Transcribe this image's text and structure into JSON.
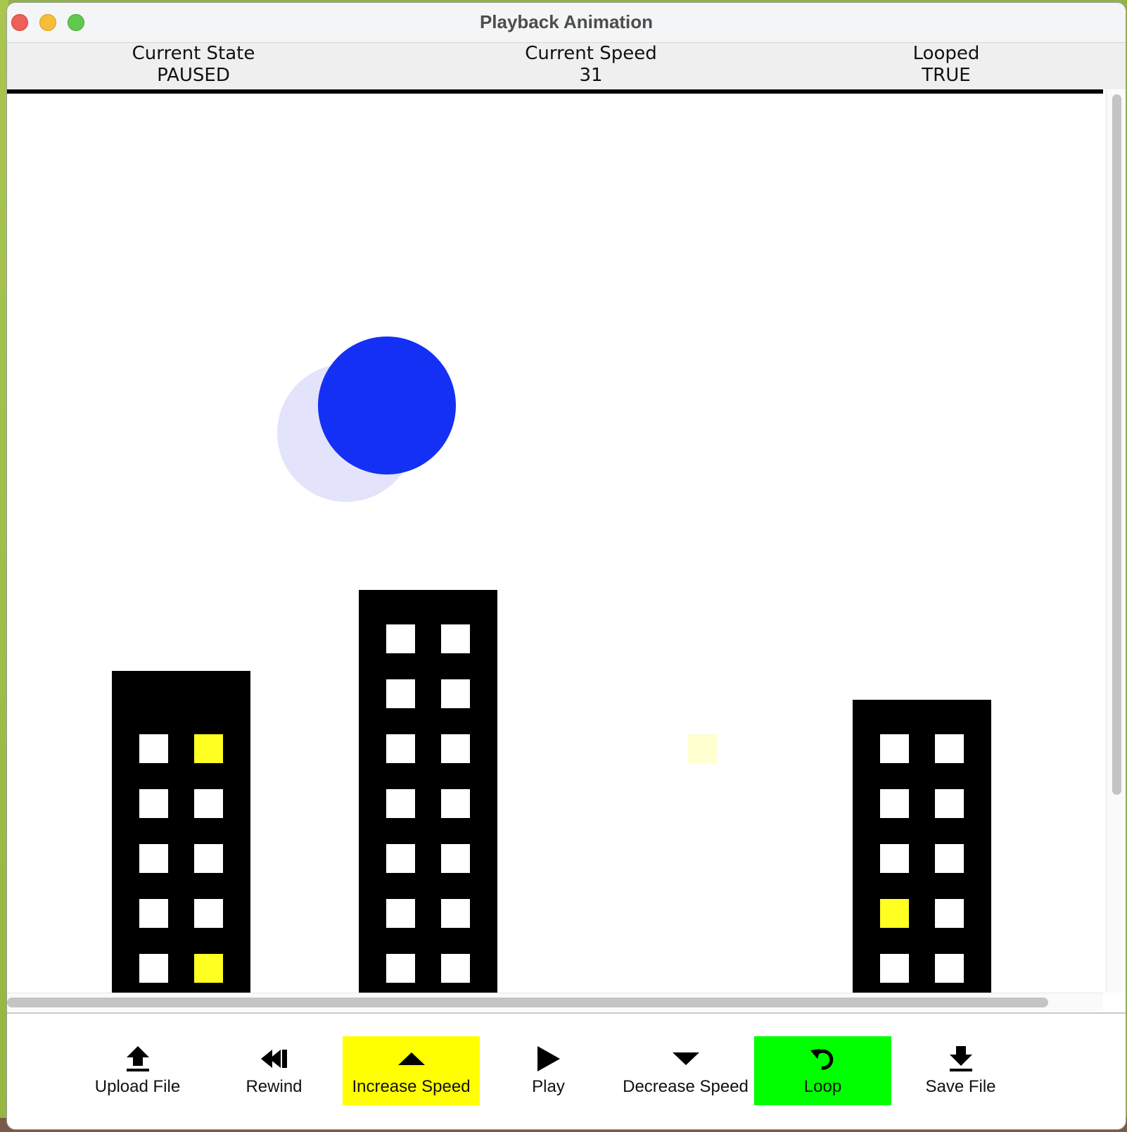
{
  "window": {
    "title": "Playback Animation"
  },
  "status": {
    "state_label": "Current State",
    "state_value": "PAUSED",
    "speed_label": "Current Speed",
    "speed_value": "31",
    "loop_label": "Looped",
    "loop_value": "TRUE"
  },
  "controls": [
    {
      "id": "upload",
      "label": "Upload File",
      "icon": "upload-arrow-icon",
      "highlight": null
    },
    {
      "id": "rewind",
      "label": "Rewind",
      "icon": "rewind-icon",
      "highlight": null
    },
    {
      "id": "increase",
      "label": "Increase Speed",
      "icon": "triangle-up-icon",
      "highlight": "#ffff00"
    },
    {
      "id": "play",
      "label": "Play",
      "icon": "play-icon",
      "highlight": null
    },
    {
      "id": "decrease",
      "label": "Decrease Speed",
      "icon": "triangle-down-icon",
      "highlight": null
    },
    {
      "id": "loop",
      "label": "Loop",
      "icon": "loop-arrow-icon",
      "highlight": "#00ff00"
    },
    {
      "id": "save",
      "label": "Save File",
      "icon": "download-arrow-icon",
      "highlight": null
    }
  ],
  "scene": {
    "colors": {
      "sun": "#1530f5",
      "sun_ghost": "#e3e4fb",
      "building": "#000000",
      "window_off": "#ffffff",
      "window_lit": "#ffff22",
      "window_fading": "#ffffd0"
    },
    "buildings": [
      {
        "name": "left",
        "lit_windows": [
          "row1-right",
          "row5-right"
        ]
      },
      {
        "name": "middle",
        "lit_windows": []
      },
      {
        "name": "right",
        "lit_windows": [
          "row4-left"
        ]
      }
    ]
  }
}
